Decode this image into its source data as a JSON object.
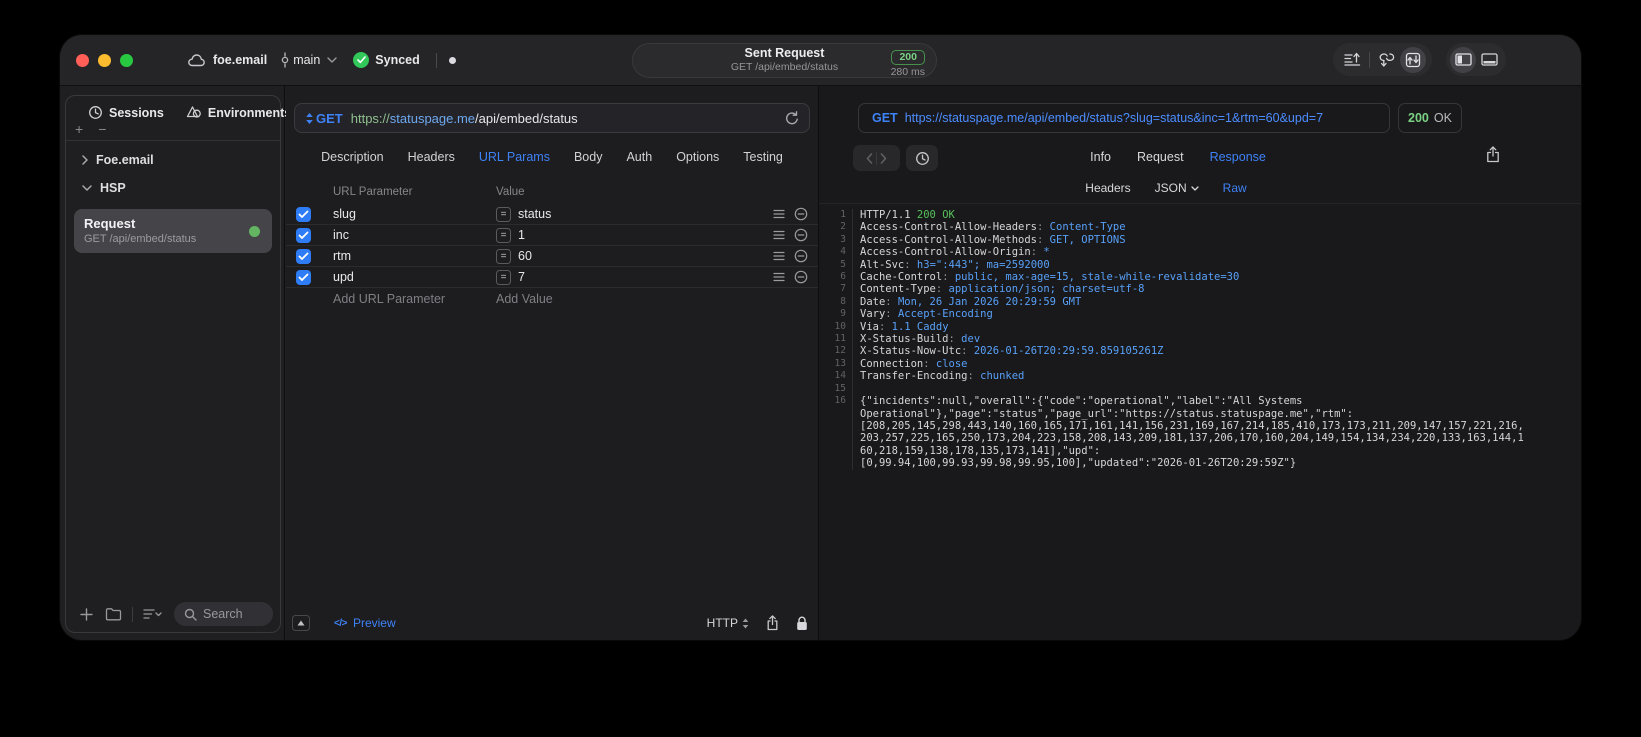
{
  "titlebar": {
    "project": "foe.email",
    "branch": "main",
    "sync_status": "Synced",
    "sent_request": {
      "title": "Sent Request",
      "subtitle": "GET /api/embed/status",
      "status_code": "200",
      "duration": "280 ms"
    }
  },
  "sidebar": {
    "tabs": [
      {
        "label": "Sessions"
      },
      {
        "label": "Environments"
      }
    ],
    "tree": [
      {
        "label": "Foe.email",
        "state": "collapsed"
      },
      {
        "label": "HSP",
        "state": "expanded"
      }
    ],
    "selected_request": {
      "title": "Request",
      "subtitle": "GET /api/embed/status"
    },
    "search_placeholder": "Search"
  },
  "request_editor": {
    "method": "GET",
    "url_scheme": "https://",
    "url_host": "statuspage.me",
    "url_path": "/api/embed/status",
    "tabs": [
      "Description",
      "Headers",
      "URL Params",
      "Body",
      "Auth",
      "Options",
      "Testing"
    ],
    "active_tab": "URL Params",
    "params_table": {
      "columns": [
        "URL Parameter",
        "Value"
      ],
      "rows": [
        {
          "enabled": true,
          "name": "slug",
          "value": "status"
        },
        {
          "enabled": true,
          "name": "inc",
          "value": "1"
        },
        {
          "enabled": true,
          "name": "rtm",
          "value": "60"
        },
        {
          "enabled": true,
          "name": "upd",
          "value": "7"
        }
      ],
      "add_name_placeholder": "Add URL Parameter",
      "add_value_placeholder": "Add Value"
    },
    "footer": {
      "preview_label": "Preview",
      "code_glyph": "</>",
      "protocol_label": "HTTP"
    }
  },
  "response_viewer": {
    "request_line": {
      "method": "GET",
      "url": "https://statuspage.me/api/embed/status?slug=status&inc=1&rtm=60&upd=7"
    },
    "status": {
      "code": "200",
      "text": "OK"
    },
    "tabs": [
      "Info",
      "Request",
      "Response"
    ],
    "active_tab": "Response",
    "subtabs": [
      "Headers",
      "JSON",
      "Raw"
    ],
    "active_subtab": "Raw",
    "code_lines": [
      {
        "n": "1",
        "segs": [
          [
            "HTTP/1.1 ",
            "w"
          ],
          [
            "200 OK",
            "g"
          ]
        ]
      },
      {
        "n": "2",
        "segs": [
          [
            "Access-Control-Allow-Headers",
            "w"
          ],
          [
            ": ",
            "d"
          ],
          [
            "Content-Type",
            "b"
          ]
        ]
      },
      {
        "n": "3",
        "segs": [
          [
            "Access-Control-Allow-Methods",
            "w"
          ],
          [
            ": ",
            "d"
          ],
          [
            "GET, OPTIONS",
            "b"
          ]
        ]
      },
      {
        "n": "4",
        "segs": [
          [
            "Access-Control-Allow-Origin",
            "w"
          ],
          [
            ": ",
            "d"
          ],
          [
            "*",
            "b"
          ]
        ]
      },
      {
        "n": "5",
        "segs": [
          [
            "Alt-Svc",
            "w"
          ],
          [
            ": ",
            "d"
          ],
          [
            "h3=\":443\"; ma=2592000",
            "b"
          ]
        ]
      },
      {
        "n": "6",
        "segs": [
          [
            "Cache-Control",
            "w"
          ],
          [
            ": ",
            "d"
          ],
          [
            "public, max-age=15, stale-while-revalidate=30",
            "b"
          ]
        ]
      },
      {
        "n": "7",
        "segs": [
          [
            "Content-Type",
            "w"
          ],
          [
            ": ",
            "d"
          ],
          [
            "application/json; charset=utf-8",
            "b"
          ]
        ]
      },
      {
        "n": "8",
        "segs": [
          [
            "Date",
            "w"
          ],
          [
            ": ",
            "d"
          ],
          [
            "Mon, 26 Jan 2026 20:29:59 GMT",
            "b"
          ]
        ]
      },
      {
        "n": "9",
        "segs": [
          [
            "Vary",
            "w"
          ],
          [
            ": ",
            "d"
          ],
          [
            "Accept-Encoding",
            "b"
          ]
        ]
      },
      {
        "n": "10",
        "segs": [
          [
            "Via",
            "w"
          ],
          [
            ": ",
            "d"
          ],
          [
            "1.1 Caddy",
            "b"
          ]
        ]
      },
      {
        "n": "11",
        "segs": [
          [
            "X-Status-Build",
            "w"
          ],
          [
            ": ",
            "d"
          ],
          [
            "dev",
            "b"
          ]
        ]
      },
      {
        "n": "12",
        "segs": [
          [
            "X-Status-Now-Utc",
            "w"
          ],
          [
            ": ",
            "d"
          ],
          [
            "2026-01-26T20:29:59.859105261Z",
            "b"
          ]
        ]
      },
      {
        "n": "13",
        "segs": [
          [
            "Connection",
            "w"
          ],
          [
            ": ",
            "d"
          ],
          [
            "close",
            "b"
          ]
        ]
      },
      {
        "n": "14",
        "segs": [
          [
            "Transfer-Encoding",
            "w"
          ],
          [
            ": ",
            "d"
          ],
          [
            "chunked",
            "b"
          ]
        ]
      },
      {
        "n": "15",
        "segs": []
      },
      {
        "n": "16",
        "segs": [
          [
            "{\"incidents\":null,\"overall\":{\"code\":\"operational\",\"label\":\"All Systems",
            "w"
          ]
        ]
      },
      {
        "n": "",
        "segs": [
          [
            "Operational\"},\"page\":\"status\",\"page_url\":\"https://status.statuspage.me\",\"rtm\":",
            "w"
          ]
        ]
      },
      {
        "n": "",
        "segs": [
          [
            "[208,205,145,298,443,140,160,165,171,161,141,156,231,169,167,214,185,410,173,173,211,209,147,157,221,216,",
            "w"
          ]
        ]
      },
      {
        "n": "",
        "segs": [
          [
            "203,257,225,165,250,173,204,223,158,208,143,209,181,137,206,170,160,204,149,154,134,234,220,133,163,144,1",
            "w"
          ]
        ]
      },
      {
        "n": "",
        "segs": [
          [
            "60,218,159,138,178,135,173,141],\"upd\":",
            "w"
          ]
        ]
      },
      {
        "n": "",
        "segs": [
          [
            "[0,99.94,100,99.93,99.98,99.95,100],\"updated\":\"2026-01-26T20:29:59Z\"}",
            "w"
          ]
        ]
      }
    ]
  },
  "colors": {
    "accent_blue": "#3e82f7",
    "code_value_blue": "#58a0f8",
    "success_green": "#56c15b",
    "status_dot_green": "#63b562",
    "checkbox_blue": "#2e7cf6",
    "traffic_red": "#ff5f57",
    "traffic_yellow": "#febc2e",
    "traffic_green": "#28c840"
  }
}
